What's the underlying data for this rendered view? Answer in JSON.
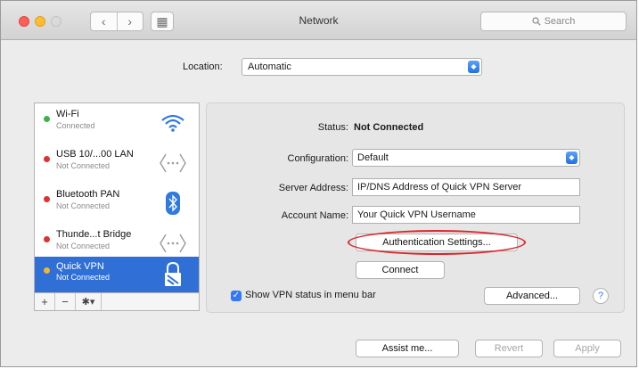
{
  "window": {
    "title": "Network"
  },
  "toolbar": {
    "back": "‹",
    "forward": "›",
    "grid": "▦",
    "search_placeholder": "Search"
  },
  "location": {
    "label": "Location:",
    "value": "Automatic"
  },
  "services": [
    {
      "name": "Wi-Fi",
      "status": "Connected",
      "dot_color": "#3cb44b",
      "icon": "wifi-icon"
    },
    {
      "name": "USB 10/...00 LAN",
      "status": "Not Connected",
      "dot_color": "#e03030",
      "icon": "ethernet-icon"
    },
    {
      "name": "Bluetooth PAN",
      "status": "Not Connected",
      "dot_color": "#e03030",
      "icon": "bluetooth-icon"
    },
    {
      "name": "Thunde...t Bridge",
      "status": "Not Connected",
      "dot_color": "#e03030",
      "icon": "ethernet-icon"
    },
    {
      "name": "Quick VPN",
      "status": "Not Connected",
      "dot_color": "#f2b632",
      "icon": "lock-icon",
      "selected": true
    }
  ],
  "sidebar_tools": {
    "add": "+",
    "remove": "−",
    "gear": "✱▾"
  },
  "detail": {
    "status_label": "Status:",
    "status_value": "Not Connected",
    "configuration_label": "Configuration:",
    "configuration_value": "Default",
    "server_label": "Server Address:",
    "server_value": "IP/DNS Address of Quick VPN Server",
    "account_label": "Account Name:",
    "account_value": "Your Quick VPN Username",
    "auth_button": "Authentication Settings...",
    "connect_button": "Connect",
    "show_vpn_status": "Show VPN status in menu bar",
    "show_vpn_checked": true,
    "advanced_button": "Advanced...",
    "help": "?"
  },
  "bottom": {
    "assist": "Assist me...",
    "revert": "Revert",
    "apply": "Apply"
  },
  "colors": {
    "accent": "#3478f6",
    "selection": "#2f6fd6",
    "highlight_oval": "#d8262c"
  }
}
